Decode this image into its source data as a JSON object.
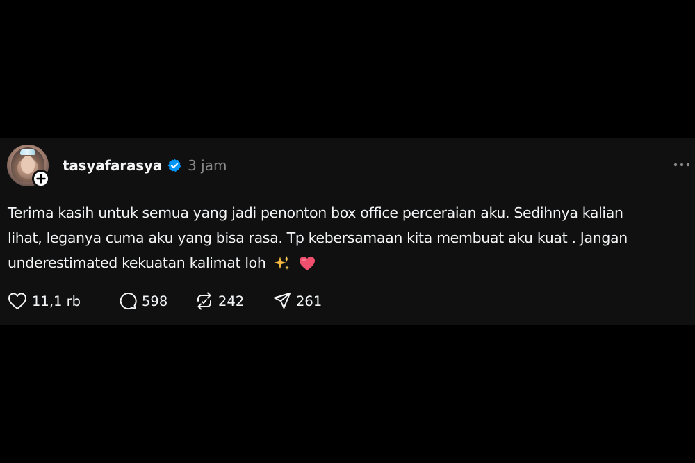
{
  "post": {
    "username": "tasyafarasya",
    "verified": true,
    "time": "3 jam",
    "text_lines": [
      "Terima kasih untuk semua yang jadi penonton box office perceraian aku. Sedihnya kalian",
      "lihat, leganya cuma aku yang bisa rasa. Tp kebersamaan kita membuat aku kuat . Jangan",
      "underestimated kekuatan kalimat loh"
    ],
    "emojis": [
      "sparkles-icon",
      "heart-icon"
    ],
    "actions": {
      "likes": "11,1 rb",
      "replies": "598",
      "reposts": "242",
      "shares": "261"
    }
  },
  "colors": {
    "page_background": "#000000",
    "card_background": "#101010",
    "text_primary": "#f3f5f7",
    "text_secondary": "#8a8a8a",
    "verified_blue": "#0095f6",
    "heart_pink": "#f0506e",
    "sparkle_gold": "#f5b942"
  }
}
